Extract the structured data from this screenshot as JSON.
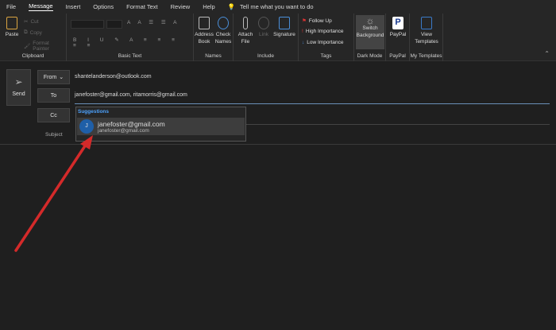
{
  "menu": {
    "items": [
      "File",
      "Message",
      "Insert",
      "Options",
      "Format Text",
      "Review",
      "Help"
    ],
    "tell_me": "Tell me what you want to do"
  },
  "ribbon": {
    "clipboard": {
      "paste": "Paste",
      "cut": "Cut",
      "copy": "Copy",
      "format_painter": "Format Painter",
      "label": "Clipboard"
    },
    "basic_text": {
      "label": "Basic Text"
    },
    "names": {
      "address_book": "Address Book",
      "check_names": "Check Names",
      "label": "Names"
    },
    "include": {
      "attach_file": "Attach File",
      "link": "Link",
      "signature": "Signature",
      "label": "Include"
    },
    "tags": {
      "follow_up": "Follow Up",
      "high": "High Importance",
      "low": "Low Importance",
      "label": "Tags"
    },
    "dark_mode": {
      "switch": "Switch Background",
      "label": "Dark Mode"
    },
    "paypal": {
      "button": "PayPal",
      "label": "PayPal"
    },
    "templates": {
      "view": "View Templates",
      "label": "My Templates"
    }
  },
  "compose": {
    "send": "Send",
    "from_label": "From",
    "from_value": "shantelanderson@outlook.com",
    "to_label": "To",
    "to_value": "janefoster@gmail.com, ritamorris@gmail.com",
    "cc_label": "Cc",
    "subject_label": "Subject"
  },
  "suggestions": {
    "header": "Suggestions",
    "items": [
      {
        "initial": "J",
        "name": "janefoster@gmail.com",
        "email": "janefoster@gmail.com"
      }
    ]
  },
  "colors": {
    "accent": "#1f5fa8",
    "arrow": "#d42a2a",
    "link": "#4da3ff"
  }
}
